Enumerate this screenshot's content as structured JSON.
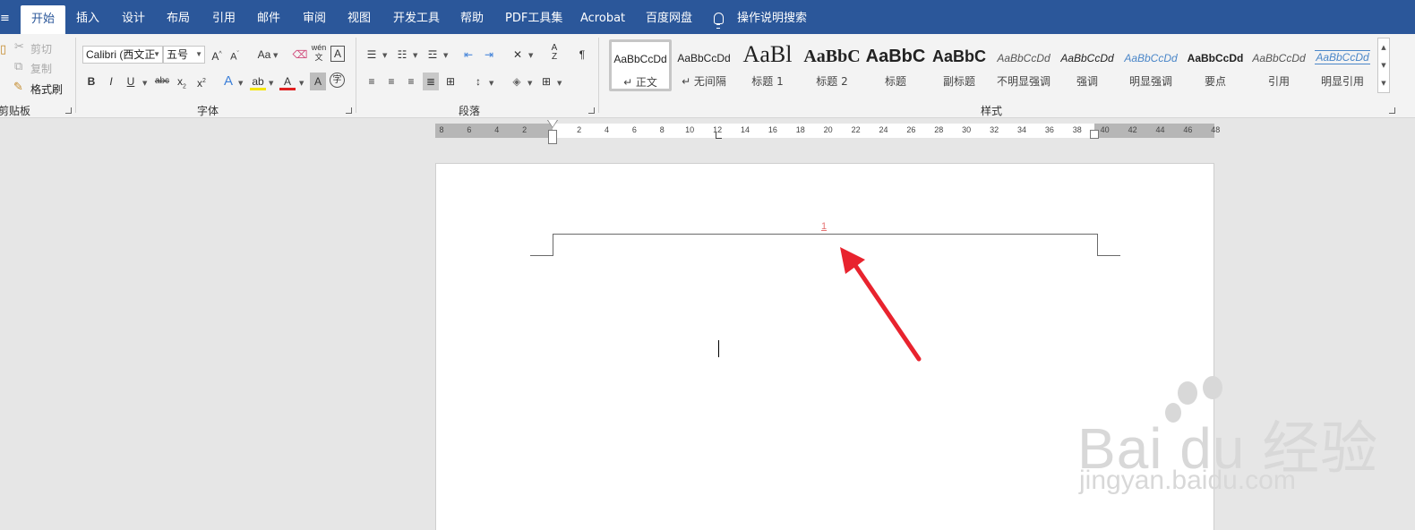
{
  "tabs": [
    {
      "label": "开始",
      "active": true
    },
    {
      "label": "插入"
    },
    {
      "label": "设计"
    },
    {
      "label": "布局"
    },
    {
      "label": "引用"
    },
    {
      "label": "邮件"
    },
    {
      "label": "审阅"
    },
    {
      "label": "视图"
    },
    {
      "label": "开发工具"
    },
    {
      "label": "帮助"
    },
    {
      "label": "PDF工具集"
    },
    {
      "label": "Acrobat"
    },
    {
      "label": "百度网盘"
    }
  ],
  "tell_me": "操作说明搜索",
  "clipboard": {
    "cut": "剪切",
    "copy": "复制",
    "format_painter": "格式刷",
    "group_label": "剪贴板"
  },
  "font": {
    "font_name": "Calibri (西文正",
    "font_size": "五号",
    "group_label": "字体",
    "font_color": "#e02020"
  },
  "paragraph": {
    "group_label": "段落"
  },
  "styles": {
    "group_label": "样式",
    "items": [
      {
        "preview": "AaBbCcDd",
        "name": "↵ 正文",
        "selected": true
      },
      {
        "preview": "AaBbCcDd",
        "name": "↵ 无间隔"
      },
      {
        "preview": "AaBl",
        "name": "标题 1"
      },
      {
        "preview": "AaBbC",
        "name": "标题 2"
      },
      {
        "preview": "AaBbC",
        "name": "标题"
      },
      {
        "preview": "AaBbC",
        "name": "副标题"
      },
      {
        "preview": "AaBbCcDd",
        "name": "不明显强调"
      },
      {
        "preview": "AaBbCcDd",
        "name": "强调"
      },
      {
        "preview": "AaBbCcDd",
        "name": "明显强调"
      },
      {
        "preview": "AaBbCcDd",
        "name": "要点"
      },
      {
        "preview": "AaBbCcDd",
        "name": "引用"
      },
      {
        "preview": "AaBbCcDd",
        "name": "明显引用"
      }
    ]
  },
  "ruler": {
    "ticks": [
      "8",
      "6",
      "4",
      "2",
      "2",
      "4",
      "6",
      "8",
      "10",
      "12",
      "14",
      "16",
      "18",
      "20",
      "22",
      "24",
      "26",
      "28",
      "30",
      "32",
      "34",
      "36",
      "38",
      "40",
      "42",
      "44",
      "46",
      "48"
    ]
  },
  "document": {
    "page_number": "1"
  },
  "watermark": {
    "brand": "Bai du 经验",
    "site": "jingyan.baidu.com"
  },
  "colors": {
    "ribbon_blue": "#2b579a",
    "arrow_red": "#e8232e",
    "page_number_color": "#e57373"
  }
}
